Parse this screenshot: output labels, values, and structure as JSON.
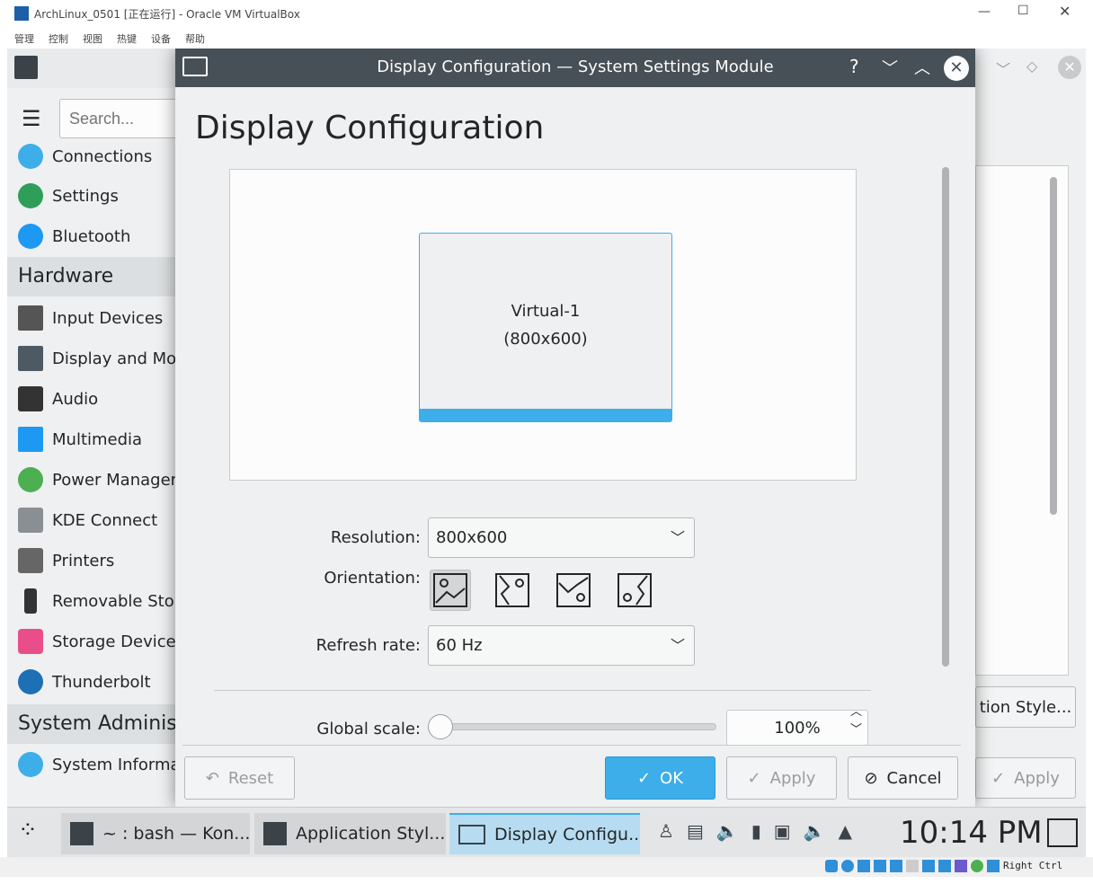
{
  "vbox": {
    "title": "ArchLinux_0501 [正在运行] - Oracle VM VirtualBox",
    "menu": [
      "管理",
      "控制",
      "视图",
      "热键",
      "设备",
      "帮助"
    ],
    "status_key": "Right Ctrl"
  },
  "sidebar": {
    "search_placeholder": "Search...",
    "items": [
      {
        "label": "Connections",
        "color": "#3daee9"
      },
      {
        "label": "Settings",
        "color": "#2e9e58"
      },
      {
        "label": "Bluetooth",
        "color": "#3daee9"
      }
    ],
    "hardware_header": "Hardware",
    "hardware": [
      {
        "label": "Input Devices",
        "color": "#555"
      },
      {
        "label": "Display and Monitor",
        "color": "#4d5a64"
      },
      {
        "label": "Audio",
        "color": "#333"
      },
      {
        "label": "Multimedia",
        "color": "#1d99f3"
      },
      {
        "label": "Power Management",
        "color": "#4caf50"
      },
      {
        "label": "KDE Connect",
        "color": "#8a8f93"
      },
      {
        "label": "Printers",
        "color": "#666"
      },
      {
        "label": "Removable Storage",
        "color": "#333"
      },
      {
        "label": "Storage Devices",
        "color": "#e94e8b"
      },
      {
        "label": "Thunderbolt",
        "color": "#1d6fb6"
      }
    ],
    "admin_header": "System Administration",
    "admin": [
      {
        "label": "System Information",
        "color": "#3daee9"
      }
    ]
  },
  "background_app": {
    "button_style": "tion Style...",
    "apply": "Apply"
  },
  "dialog": {
    "title": "Display Configuration — System Settings Module",
    "heading": "Display Configuration",
    "output": {
      "name": "Virtual-1",
      "size": "(800x600)"
    },
    "resolution_label": "Resolution:",
    "resolution": "800x600",
    "orientation_label": "Orientation:",
    "orientation_selected": 0,
    "refresh_label": "Refresh rate:",
    "refresh": "60 Hz",
    "scale_label": "Global scale:",
    "scale": "100%",
    "scale_value": 1.0,
    "buttons": {
      "reset": "Reset",
      "ok": "OK",
      "apply": "Apply",
      "cancel": "Cancel"
    }
  },
  "taskbar": {
    "tasks": [
      "~ : bash — Kon...",
      "Application Styl...",
      "Display Configu..."
    ],
    "active_task": 2,
    "clock": "10:14 PM"
  },
  "colors": {
    "accent": "#3daee9",
    "titlebar": "#475057"
  }
}
